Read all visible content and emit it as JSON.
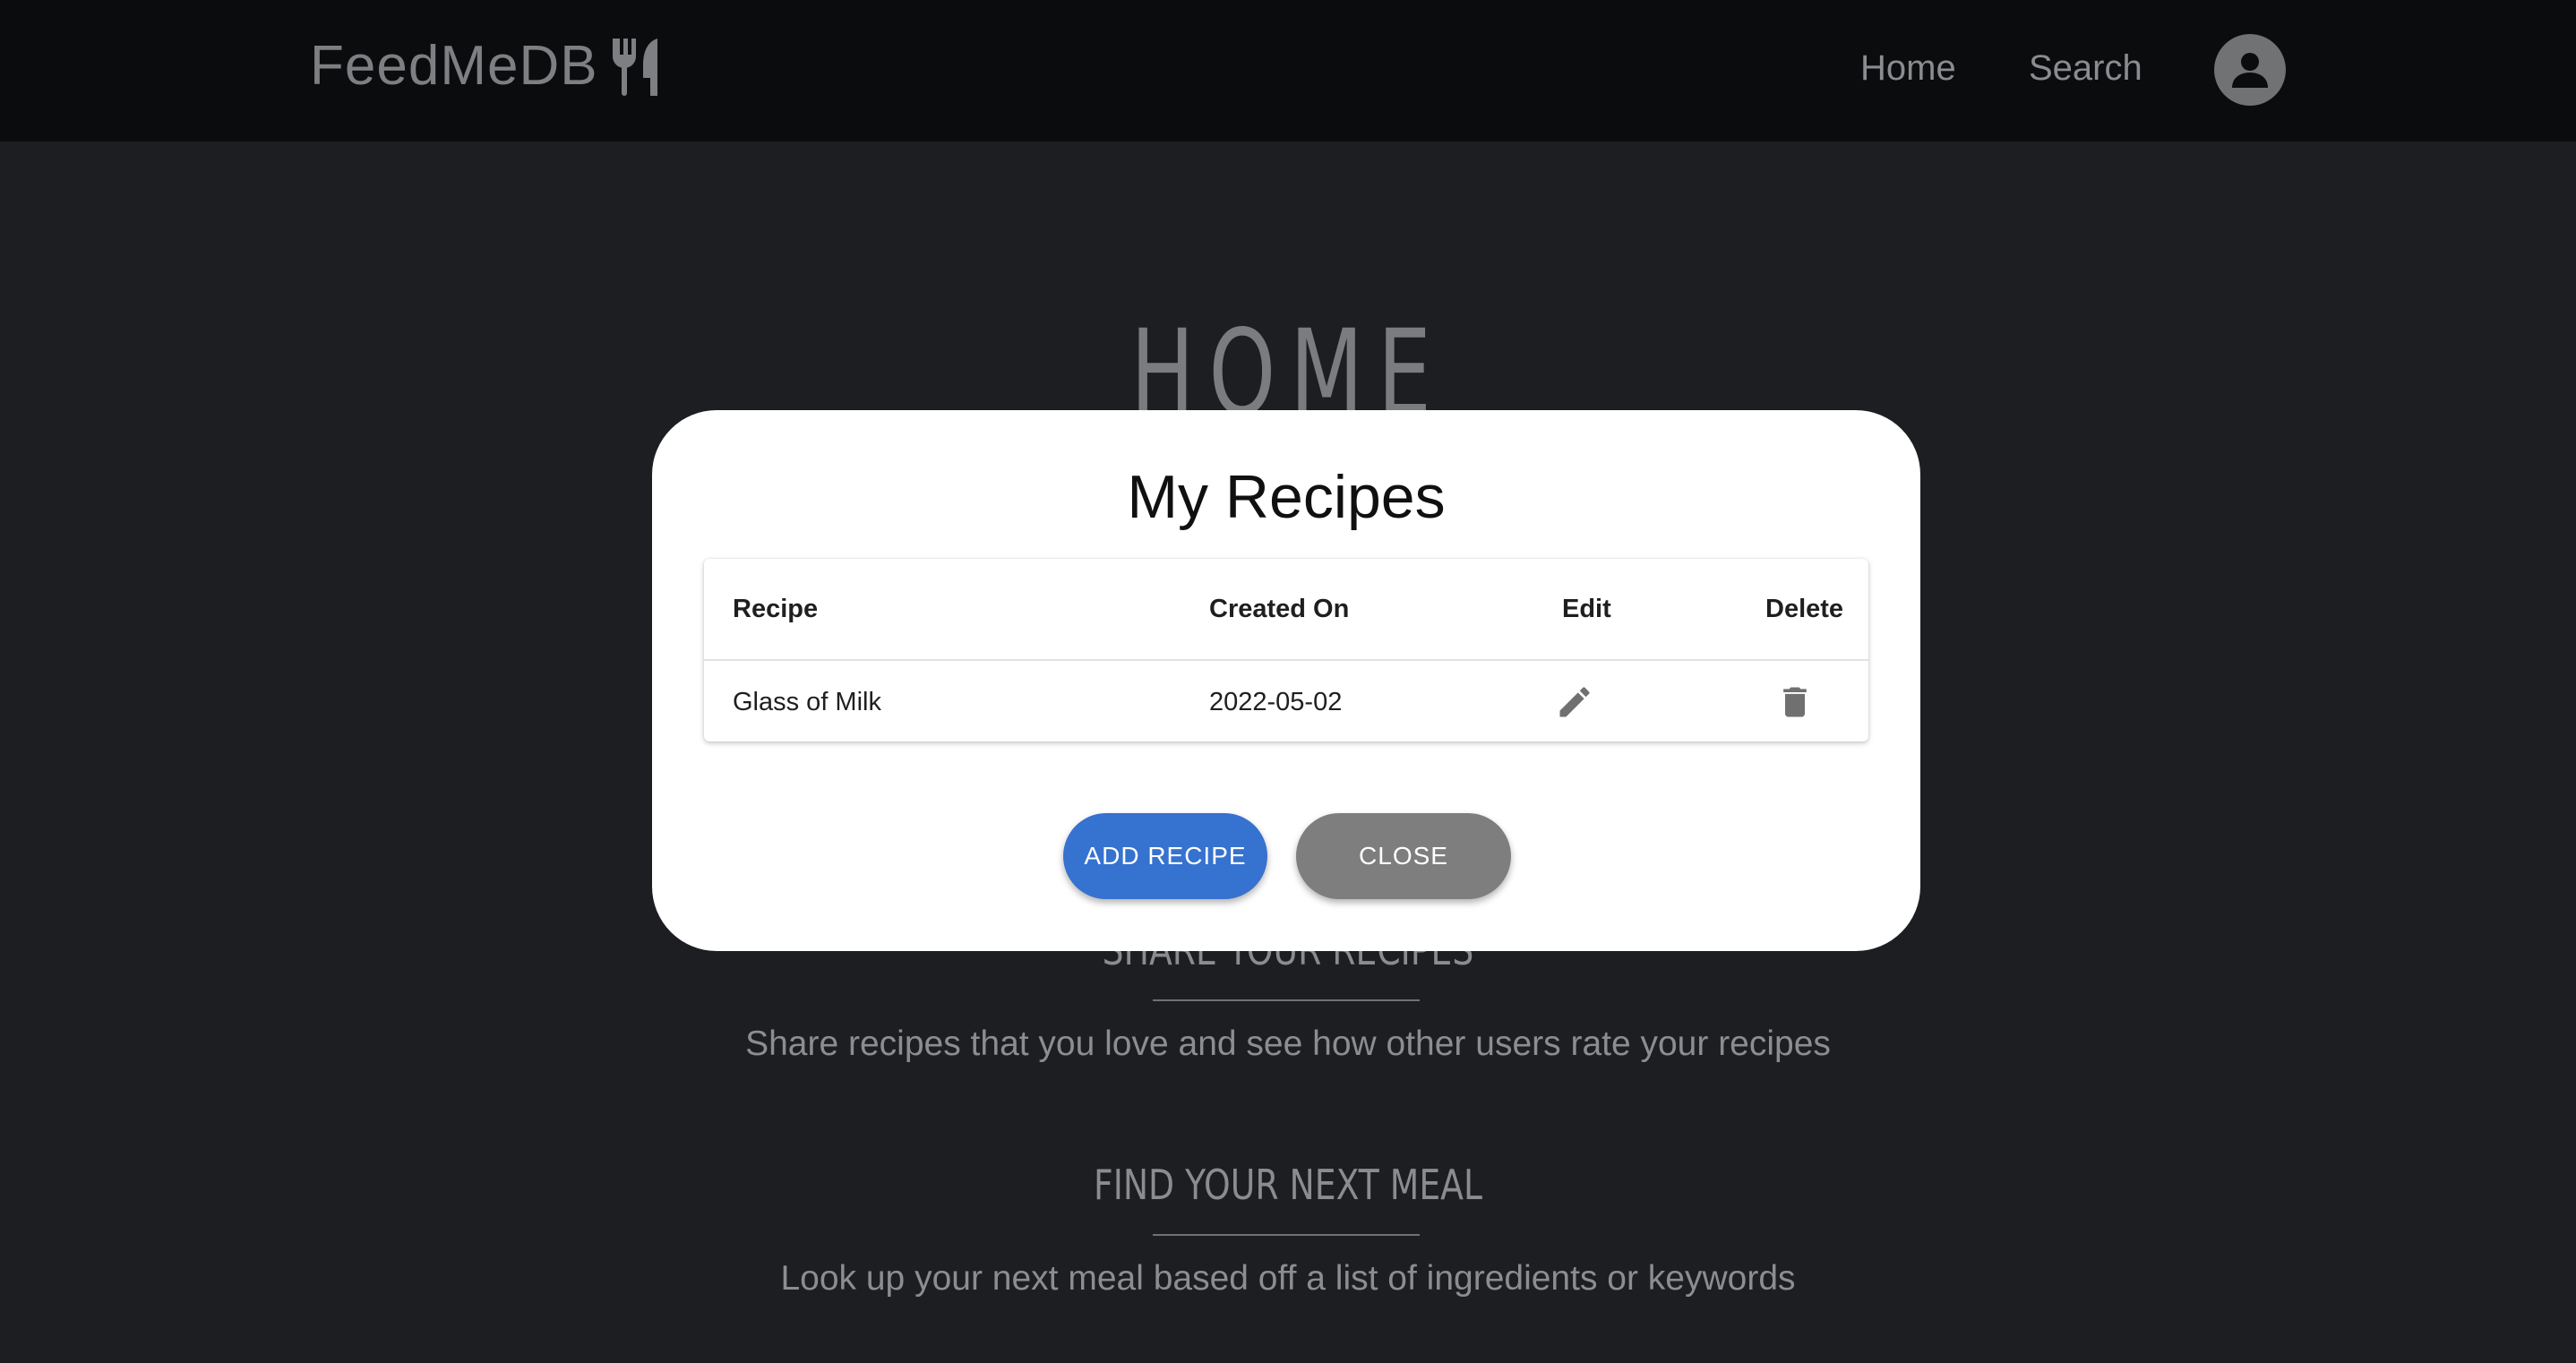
{
  "header": {
    "brand": "FeedMeDB",
    "brand_icon": "fork-knife-icon",
    "nav": [
      {
        "label": "Home"
      },
      {
        "label": "Search"
      }
    ],
    "avatar_icon": "user-icon"
  },
  "page": {
    "title": "HOME",
    "sections": [
      {
        "title": "SHARE YOUR RECIPES",
        "text": "Share recipes that you love and see how other users rate your recipes"
      },
      {
        "title": "FIND YOUR NEXT MEAL",
        "text": "Look up your next meal based off a list of ingredients or keywords"
      }
    ]
  },
  "modal": {
    "title": "My Recipes",
    "columns": [
      "Recipe",
      "Created On",
      "Edit",
      "Delete"
    ],
    "rows": [
      {
        "recipe": "Glass of Milk",
        "created_on": "2022-05-02",
        "edit_icon": "pencil-icon",
        "delete_icon": "trash-icon"
      }
    ],
    "add_label": "ADD RECIPE",
    "close_label": "CLOSE"
  },
  "colors": {
    "accent": "#3672cf",
    "close_button": "#7e7e7e",
    "header_bg": "#0b0c0e",
    "page_bg": "#1c1e22"
  }
}
